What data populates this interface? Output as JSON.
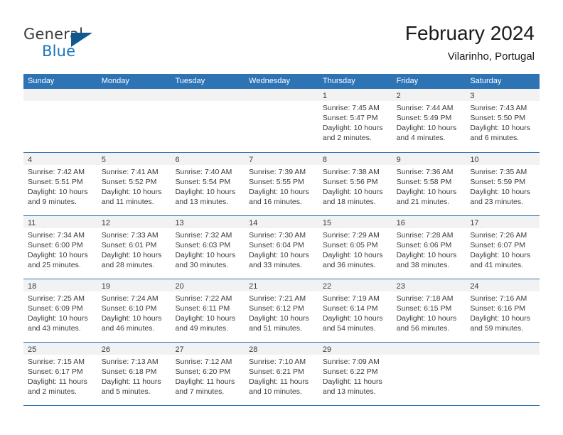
{
  "brand": {
    "word_one": "General",
    "word_two": "Blue",
    "triangle_icon": "triangle-icon",
    "accent_color": "#1a76bc"
  },
  "header": {
    "month_title": "February 2024",
    "location": "Vilarinho, Portugal"
  },
  "colors": {
    "header_blue": "#2e74b5",
    "day_band_gray": "#f2f2f2",
    "text": "#3b3b3b"
  },
  "weekdays": [
    "Sunday",
    "Monday",
    "Tuesday",
    "Wednesday",
    "Thursday",
    "Friday",
    "Saturday"
  ],
  "weeks": [
    [
      {
        "day": "",
        "sunrise": "",
        "sunset": "",
        "daylight_1": "",
        "daylight_2": ""
      },
      {
        "day": "",
        "sunrise": "",
        "sunset": "",
        "daylight_1": "",
        "daylight_2": ""
      },
      {
        "day": "",
        "sunrise": "",
        "sunset": "",
        "daylight_1": "",
        "daylight_2": ""
      },
      {
        "day": "",
        "sunrise": "",
        "sunset": "",
        "daylight_1": "",
        "daylight_2": ""
      },
      {
        "day": "1",
        "sunrise": "Sunrise: 7:45 AM",
        "sunset": "Sunset: 5:47 PM",
        "daylight_1": "Daylight: 10 hours",
        "daylight_2": "and 2 minutes."
      },
      {
        "day": "2",
        "sunrise": "Sunrise: 7:44 AM",
        "sunset": "Sunset: 5:49 PM",
        "daylight_1": "Daylight: 10 hours",
        "daylight_2": "and 4 minutes."
      },
      {
        "day": "3",
        "sunrise": "Sunrise: 7:43 AM",
        "sunset": "Sunset: 5:50 PM",
        "daylight_1": "Daylight: 10 hours",
        "daylight_2": "and 6 minutes."
      }
    ],
    [
      {
        "day": "4",
        "sunrise": "Sunrise: 7:42 AM",
        "sunset": "Sunset: 5:51 PM",
        "daylight_1": "Daylight: 10 hours",
        "daylight_2": "and 9 minutes."
      },
      {
        "day": "5",
        "sunrise": "Sunrise: 7:41 AM",
        "sunset": "Sunset: 5:52 PM",
        "daylight_1": "Daylight: 10 hours",
        "daylight_2": "and 11 minutes."
      },
      {
        "day": "6",
        "sunrise": "Sunrise: 7:40 AM",
        "sunset": "Sunset: 5:54 PM",
        "daylight_1": "Daylight: 10 hours",
        "daylight_2": "and 13 minutes."
      },
      {
        "day": "7",
        "sunrise": "Sunrise: 7:39 AM",
        "sunset": "Sunset: 5:55 PM",
        "daylight_1": "Daylight: 10 hours",
        "daylight_2": "and 16 minutes."
      },
      {
        "day": "8",
        "sunrise": "Sunrise: 7:38 AM",
        "sunset": "Sunset: 5:56 PM",
        "daylight_1": "Daylight: 10 hours",
        "daylight_2": "and 18 minutes."
      },
      {
        "day": "9",
        "sunrise": "Sunrise: 7:36 AM",
        "sunset": "Sunset: 5:58 PM",
        "daylight_1": "Daylight: 10 hours",
        "daylight_2": "and 21 minutes."
      },
      {
        "day": "10",
        "sunrise": "Sunrise: 7:35 AM",
        "sunset": "Sunset: 5:59 PM",
        "daylight_1": "Daylight: 10 hours",
        "daylight_2": "and 23 minutes."
      }
    ],
    [
      {
        "day": "11",
        "sunrise": "Sunrise: 7:34 AM",
        "sunset": "Sunset: 6:00 PM",
        "daylight_1": "Daylight: 10 hours",
        "daylight_2": "and 25 minutes."
      },
      {
        "day": "12",
        "sunrise": "Sunrise: 7:33 AM",
        "sunset": "Sunset: 6:01 PM",
        "daylight_1": "Daylight: 10 hours",
        "daylight_2": "and 28 minutes."
      },
      {
        "day": "13",
        "sunrise": "Sunrise: 7:32 AM",
        "sunset": "Sunset: 6:03 PM",
        "daylight_1": "Daylight: 10 hours",
        "daylight_2": "and 30 minutes."
      },
      {
        "day": "14",
        "sunrise": "Sunrise: 7:30 AM",
        "sunset": "Sunset: 6:04 PM",
        "daylight_1": "Daylight: 10 hours",
        "daylight_2": "and 33 minutes."
      },
      {
        "day": "15",
        "sunrise": "Sunrise: 7:29 AM",
        "sunset": "Sunset: 6:05 PM",
        "daylight_1": "Daylight: 10 hours",
        "daylight_2": "and 36 minutes."
      },
      {
        "day": "16",
        "sunrise": "Sunrise: 7:28 AM",
        "sunset": "Sunset: 6:06 PM",
        "daylight_1": "Daylight: 10 hours",
        "daylight_2": "and 38 minutes."
      },
      {
        "day": "17",
        "sunrise": "Sunrise: 7:26 AM",
        "sunset": "Sunset: 6:07 PM",
        "daylight_1": "Daylight: 10 hours",
        "daylight_2": "and 41 minutes."
      }
    ],
    [
      {
        "day": "18",
        "sunrise": "Sunrise: 7:25 AM",
        "sunset": "Sunset: 6:09 PM",
        "daylight_1": "Daylight: 10 hours",
        "daylight_2": "and 43 minutes."
      },
      {
        "day": "19",
        "sunrise": "Sunrise: 7:24 AM",
        "sunset": "Sunset: 6:10 PM",
        "daylight_1": "Daylight: 10 hours",
        "daylight_2": "and 46 minutes."
      },
      {
        "day": "20",
        "sunrise": "Sunrise: 7:22 AM",
        "sunset": "Sunset: 6:11 PM",
        "daylight_1": "Daylight: 10 hours",
        "daylight_2": "and 49 minutes."
      },
      {
        "day": "21",
        "sunrise": "Sunrise: 7:21 AM",
        "sunset": "Sunset: 6:12 PM",
        "daylight_1": "Daylight: 10 hours",
        "daylight_2": "and 51 minutes."
      },
      {
        "day": "22",
        "sunrise": "Sunrise: 7:19 AM",
        "sunset": "Sunset: 6:14 PM",
        "daylight_1": "Daylight: 10 hours",
        "daylight_2": "and 54 minutes."
      },
      {
        "day": "23",
        "sunrise": "Sunrise: 7:18 AM",
        "sunset": "Sunset: 6:15 PM",
        "daylight_1": "Daylight: 10 hours",
        "daylight_2": "and 56 minutes."
      },
      {
        "day": "24",
        "sunrise": "Sunrise: 7:16 AM",
        "sunset": "Sunset: 6:16 PM",
        "daylight_1": "Daylight: 10 hours",
        "daylight_2": "and 59 minutes."
      }
    ],
    [
      {
        "day": "25",
        "sunrise": "Sunrise: 7:15 AM",
        "sunset": "Sunset: 6:17 PM",
        "daylight_1": "Daylight: 11 hours",
        "daylight_2": "and 2 minutes."
      },
      {
        "day": "26",
        "sunrise": "Sunrise: 7:13 AM",
        "sunset": "Sunset: 6:18 PM",
        "daylight_1": "Daylight: 11 hours",
        "daylight_2": "and 5 minutes."
      },
      {
        "day": "27",
        "sunrise": "Sunrise: 7:12 AM",
        "sunset": "Sunset: 6:20 PM",
        "daylight_1": "Daylight: 11 hours",
        "daylight_2": "and 7 minutes."
      },
      {
        "day": "28",
        "sunrise": "Sunrise: 7:10 AM",
        "sunset": "Sunset: 6:21 PM",
        "daylight_1": "Daylight: 11 hours",
        "daylight_2": "and 10 minutes."
      },
      {
        "day": "29",
        "sunrise": "Sunrise: 7:09 AM",
        "sunset": "Sunset: 6:22 PM",
        "daylight_1": "Daylight: 11 hours",
        "daylight_2": "and 13 minutes."
      },
      {
        "day": "",
        "sunrise": "",
        "sunset": "",
        "daylight_1": "",
        "daylight_2": ""
      },
      {
        "day": "",
        "sunrise": "",
        "sunset": "",
        "daylight_1": "",
        "daylight_2": ""
      }
    ]
  ]
}
